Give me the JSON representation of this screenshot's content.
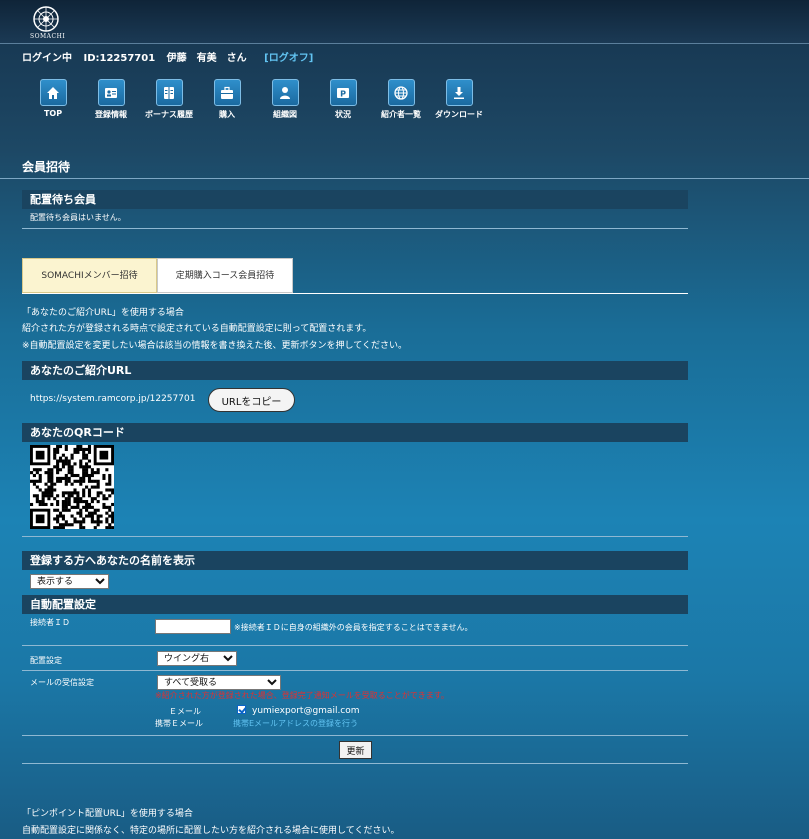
{
  "header": {
    "logo_text": "SOMACHI",
    "login_status": "ログイン中",
    "member_id": "ID:12257701",
    "user_name": "伊藤　有美　さん",
    "logout": "[ログオフ]"
  },
  "nav": [
    {
      "label": "TOP",
      "icon": "home-icon"
    },
    {
      "label": "登録情報",
      "icon": "id-card-icon"
    },
    {
      "label": "ボーナス履歴",
      "icon": "ledger-icon"
    },
    {
      "label": "購入",
      "icon": "briefcase-icon"
    },
    {
      "label": "組織図",
      "icon": "person-icon"
    },
    {
      "label": "状況",
      "icon": "parking-sign-icon"
    },
    {
      "label": "紹介者一覧",
      "icon": "globe-icon"
    },
    {
      "label": "ダウンロード",
      "icon": "download-icon"
    }
  ],
  "page_title": "会員招待",
  "pending": {
    "heading": "配置待ち会員",
    "message": "配置待ち会員はいません。"
  },
  "tabs": [
    {
      "label": "SOMACHIメンバー招待",
      "active": true
    },
    {
      "label": "定期購入コース会員招待",
      "active": false
    }
  ],
  "intro": {
    "line1": "「あなたのご紹介URL」を使用する場合",
    "line2": "紹介された方が登録される時点で設定されている自動配置設定に則って配置されます。",
    "line3": "※自動配置設定を変更したい場合は該当の情報を書き換えた後、更新ボタンを押してください。"
  },
  "referral": {
    "heading": "あなたのご紹介URL",
    "url": "https://system.ramcorp.jp/12257701",
    "copy_button": "URLをコピー"
  },
  "qr": {
    "heading": "あなたのQRコード"
  },
  "show_name": {
    "heading": "登録する方へあなたの名前を表示",
    "selected": "表示する"
  },
  "auto": {
    "heading": "自動配置設定",
    "connector_label": "接続者ＩＤ",
    "connector_value": "",
    "connector_note": "※接続者ＩＤに自身の組織外の会員を指定することはできません。",
    "placement_label": "配置設定",
    "placement_selected": "ウイング右",
    "mail_label": "メールの受信設定",
    "mail_selected": "すべて受取る",
    "mail_note": "※紹介された方が登録された場合、登録完了通知メールを受取ることができます。",
    "email_label": "Ｅメール",
    "email_value": "yumiexport@gmail.com",
    "mobile_label": "携帯Ｅメール",
    "mobile_link": "携帯Eメールアドレスの登録を行う",
    "update_button": "更新"
  },
  "pinpoint": {
    "line1": "「ピンポイント配置URL」を使用する場合",
    "line2": "自動配置設定に関係なく、特定の場所に配置したい方を紹介される場合に使用してください。"
  },
  "colors": {
    "section_bg": "#1a4460",
    "tab_active": "#fbf4d0",
    "link": "#62c4f2",
    "warning": "#e03030"
  }
}
